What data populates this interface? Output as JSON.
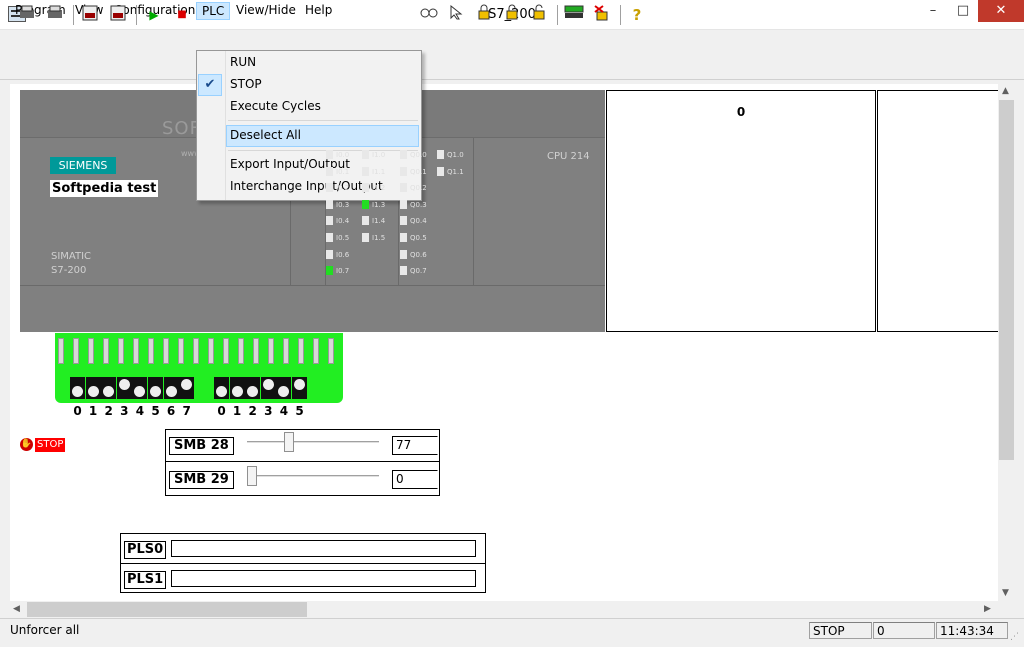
{
  "window": {
    "title": "S7_200",
    "minimize": "–",
    "maximize": "□",
    "close": "✕",
    "app_icon": "s7-app-icon"
  },
  "menu": [
    "Program",
    "View",
    "Configuration",
    "PLC",
    "View/Hide",
    "Help"
  ],
  "plc_menu": {
    "items": [
      "RUN",
      "STOP",
      "Execute Cycles",
      "Deselect All",
      "Export Input/Output",
      "Interchange Input/Output"
    ],
    "checked": "STOP",
    "highlighted": "Deselect All"
  },
  "toolbar": {
    "play": "▶",
    "stop": "■",
    "help": "?"
  },
  "plc": {
    "brand": "SIEMENS",
    "name": "Softpedia test",
    "model1": "SIMATIC",
    "model2": "S7-200",
    "cpu": "CPU 214",
    "watermark": "SOFTPEDIA",
    "watermark_url": "www.softpedia.com",
    "inputs_col1": [
      "I0.0",
      "I0.1",
      "I0.2",
      "I0.3",
      "I0.4",
      "I0.5",
      "I0.6",
      "I0.7"
    ],
    "inputs_col2": [
      "I1.0",
      "I1.1",
      "I1.2",
      "I1.3",
      "I1.4",
      "I1.5"
    ],
    "outputs_col1": [
      "Q0.0",
      "Q0.1",
      "Q0.2",
      "Q0.3",
      "Q0.4",
      "Q0.5",
      "Q0.6",
      "Q0.7"
    ],
    "outputs_col2": [
      "Q1.0",
      "Q1.1"
    ]
  },
  "counter": "0",
  "switches": {
    "row1": [
      "0",
      "1",
      "2",
      "3",
      "4",
      "5",
      "6",
      "7"
    ],
    "row2": [
      "0",
      "1",
      "2",
      "3",
      "4",
      "5"
    ]
  },
  "status_indicator": "STOP",
  "smb": [
    {
      "label": "SMB 28",
      "value": "77",
      "level": 0.3
    },
    {
      "label": "SMB 29",
      "value": "0",
      "level": 0
    }
  ],
  "pls": [
    "PLS0",
    "PLS1"
  ],
  "statusbar": {
    "message": "Unforcer all",
    "mode": "STOP",
    "count": "0",
    "time": "11:43:34"
  }
}
